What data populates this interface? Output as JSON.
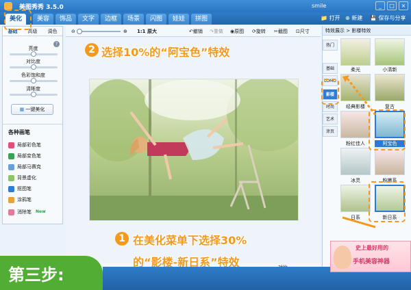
{
  "window": {
    "app_title": "美图秀秀 3.5.0",
    "user": "smile",
    "buttons": [
      "_",
      "□",
      "×"
    ]
  },
  "tabs": [
    {
      "label": "美化",
      "active": true
    },
    {
      "label": "美容"
    },
    {
      "label": "饰品"
    },
    {
      "label": "文字"
    },
    {
      "label": "边框"
    },
    {
      "label": "场景"
    },
    {
      "label": "闪图"
    },
    {
      "label": "娃娃"
    },
    {
      "label": "拼图"
    }
  ],
  "toolbar": {
    "open": "打开",
    "new": "新建",
    "save_share": "保存与分享"
  },
  "left_panel": {
    "subtabs": [
      "基础",
      "高级",
      "调色"
    ],
    "sliders": [
      {
        "label": "亮度",
        "value": 0.5
      },
      {
        "label": "对比度",
        "value": 0.5
      },
      {
        "label": "色彩饱和度",
        "value": 0.5
      },
      {
        "label": "清晰度",
        "value": 0.5
      }
    ],
    "one_key": "一键美化",
    "brushes_title": "各种画笔",
    "brushes": [
      {
        "label": "局部彩色笔",
        "color": "#e0507a"
      },
      {
        "label": "局部变色笔",
        "color": "#3aa05a"
      },
      {
        "label": "局部马赛克",
        "color": "#6aa0d8"
      },
      {
        "label": "背景虚化",
        "color": "#8fc36a"
      },
      {
        "label": "抠图笔",
        "color": "#2f7dd0"
      },
      {
        "label": "涂鸦笔",
        "color": "#e8a23a"
      },
      {
        "label": "消除笔",
        "color": "#e07c9a",
        "badge": "New"
      }
    ]
  },
  "center_toolbar": {
    "zoom_label": "1:1 原大",
    "undo": "撤销",
    "redo": "重做",
    "original": "原图",
    "rotate": "旋转",
    "crop": "截图",
    "size": "尺寸"
  },
  "statusbar": {
    "contrast": "对比"
  },
  "right_panel": {
    "header": "特效展示 > 影楼特效",
    "categories": [
      {
        "label": "热门"
      },
      {
        "label": "基础"
      },
      {
        "label": "LOMO"
      },
      {
        "label": "影楼",
        "active": true
      },
      {
        "label": "时尚"
      },
      {
        "label": "艺术"
      },
      {
        "label": "涂页"
      }
    ],
    "thumbs": [
      {
        "label": "柔光"
      },
      {
        "label": "小清新"
      },
      {
        "label": "经典影楼"
      },
      {
        "label": "复古"
      },
      {
        "label": "粉红佳人"
      },
      {
        "label": "阿宝色",
        "selected": true
      },
      {
        "label": "冰灵"
      },
      {
        "label": "粉嫩系"
      },
      {
        "label": "日系"
      },
      {
        "label": "新日系",
        "selected": true
      }
    ]
  },
  "annotations": {
    "step1_num": "1",
    "step1_line1": "在美化菜单下选择30%",
    "step1_line2": "的“影楼-新日系”特效",
    "step2_num": "2",
    "step2_text": "选择10%的“阿宝色”特效",
    "step_label": "第三步:",
    "accent": "#f39a1e"
  },
  "banner": {
    "line1": "史上最好用的",
    "line2": "手机美容神器"
  },
  "colors": {
    "chrome_blue": "#2a75c2",
    "accent_orange": "#f39a1e",
    "step_green": "#52ad34"
  }
}
